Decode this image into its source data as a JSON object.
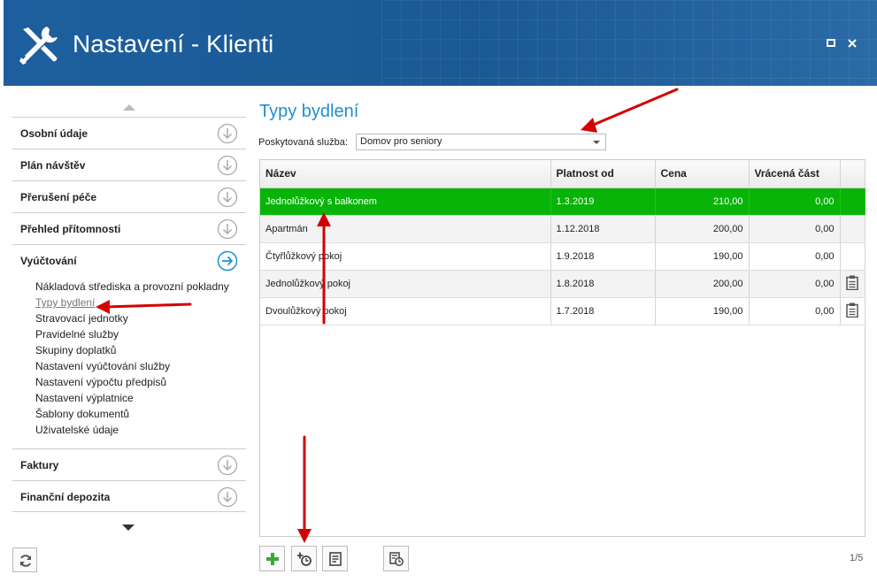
{
  "window": {
    "title": "Nastavení - Klienti"
  },
  "sidebar": {
    "sections": [
      {
        "label": "Osobní údaje"
      },
      {
        "label": "Plán návštěv"
      },
      {
        "label": "Přerušení péče"
      },
      {
        "label": "Přehled přítomnosti"
      },
      {
        "label": "Vyúčtování"
      },
      {
        "label": "Faktury"
      },
      {
        "label": "Finanční depozita"
      }
    ],
    "subitems": [
      "Nákladová střediska a provozní pokladny",
      "Typy bydlení",
      "Stravovací jednotky",
      "Pravidelné služby",
      "Skupiny doplatků",
      "Nastavení vyúčtování služby",
      "Nastavení výpočtu předpisů",
      "Nastavení výplatnice",
      "Šablony dokumentů",
      "Uživatelské údaje"
    ]
  },
  "main": {
    "title": "Typy bydlení",
    "service_label": "Poskytovaná služba:",
    "service_value": "Domov pro seniory",
    "columns": [
      "Název",
      "Platnost od",
      "Cena",
      "Vrácená část"
    ],
    "rows": [
      {
        "name": "Jednolůžkový s balkonem",
        "valid_from": "1.3.2019",
        "price": "210,00",
        "refund": "0,00",
        "selected": true,
        "note_icon": false
      },
      {
        "name": "Apartmán",
        "valid_from": "1.12.2018",
        "price": "200,00",
        "refund": "0,00",
        "selected": false,
        "note_icon": false
      },
      {
        "name": "Čtyřlůžkový pokoj",
        "valid_from": "1.9.2018",
        "price": "190,00",
        "refund": "0,00",
        "selected": false,
        "note_icon": false
      },
      {
        "name": "Jednolůžkový pokoj",
        "valid_from": "1.8.2018",
        "price": "200,00",
        "refund": "0,00",
        "selected": false,
        "note_icon": true
      },
      {
        "name": "Dvoulůžkový pokoj",
        "valid_from": "1.7.2018",
        "price": "190,00",
        "refund": "0,00",
        "selected": false,
        "note_icon": true
      }
    ],
    "pager": "1/5"
  },
  "icons": {
    "app": "tools-icon",
    "sections": "arrow-down-circle-icon",
    "active_section": "arrow-right-circle-icon",
    "row_note": "clipboard-icon",
    "toolbar": [
      "add-icon",
      "add-history-icon",
      "edit-icon",
      "history-icon"
    ],
    "refresh": "refresh-icon"
  },
  "colors": {
    "titlebar": "#1d5f9e",
    "accent": "#1e8fd0",
    "selected_row": "#08b408",
    "add_green": "#3aa832",
    "annotation_red": "#d40000"
  }
}
